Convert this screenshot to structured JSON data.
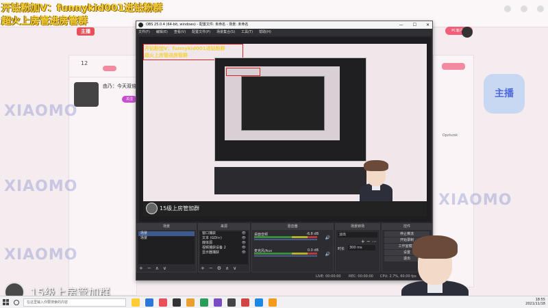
{
  "overlay": {
    "line1": "开钻粉加V：funnykid001进钻粉群",
    "line2": "超火上房管进房管群",
    "lower_label": "15级上房管加群"
  },
  "background_page": {
    "count": "12",
    "count_label": "",
    "streamer_name": "由乃：今天双倍",
    "watermark": "XIAOMO",
    "sticker": "主播",
    "right_name": "Dpzlvzsk",
    "follow_label": "关注"
  },
  "obs": {
    "title": "OBS 25.0.4 (64-bit, windows) - 配置文件: 未命名 - 场景: 未命名",
    "menu": [
      "文件(F)",
      "编辑(E)",
      "查看(V)",
      "配置文件(P)",
      "场景集合(S)",
      "工具(T)",
      "帮助(H)"
    ],
    "preview_banner1": "开钻粉加V：funnykid001进钻粉群",
    "preview_banner2": "超火上房管进房管群",
    "preview_lower": "15级上房管加群",
    "docks": {
      "scenes": {
        "header": "场景",
        "items": [
          "场景",
          "场景"
        ]
      },
      "sources": {
        "header": "来源",
        "items": [
          "窗口捕获",
          "文本 (GDI+)",
          "媒体源",
          "视频捕获设备 2",
          "显示器捕获"
        ]
      },
      "mixer": {
        "header": "混音器",
        "channels": [
          {
            "name": "桌面音频",
            "db": "-6.8 dB"
          },
          {
            "name": "麦克风/Aux",
            "db": "0.0 dB"
          }
        ]
      },
      "transitions": {
        "header": "场景转场",
        "type": "淡出",
        "duration_label": "时长",
        "duration": "300 ms"
      },
      "controls": {
        "header": "控件",
        "buttons": [
          "停止推流",
          "开始录制",
          "工作室模式",
          "设置",
          "退出"
        ]
      }
    },
    "status": {
      "live": "LIVE: 00:00:00",
      "rec": "REC: 00:00:00",
      "cpu": "CPU: 2.7%, 60.00 fps"
    }
  },
  "taskbar": {
    "search_placeholder": "在这里输入你要搜索的内容",
    "time": "18:55",
    "date": "2021/11/18",
    "icon_colors": [
      "#ffcc33",
      "#2f77d6",
      "#e8505b",
      "#333333",
      "#e8a030",
      "#2b9c5a",
      "#7a4cc2",
      "#444444",
      "#d14545",
      "#1e88e5",
      "#f29b1d"
    ]
  }
}
